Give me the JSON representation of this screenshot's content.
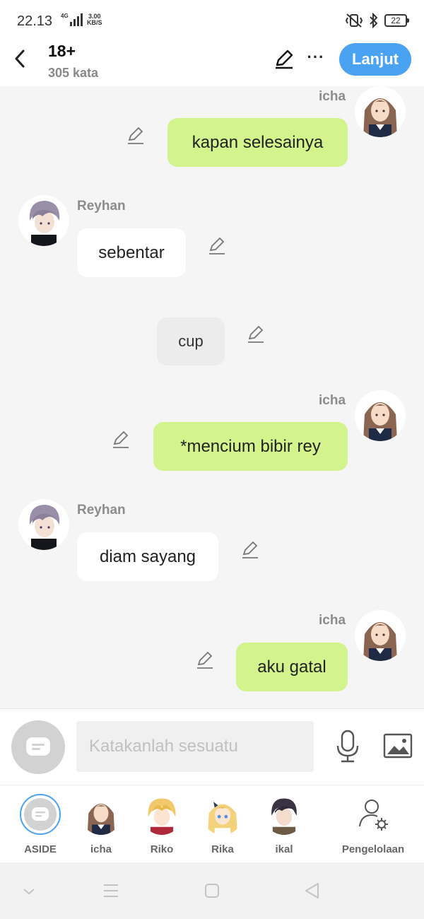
{
  "status_bar": {
    "time": "22.13",
    "network": "4G",
    "speed_top": "3.00",
    "speed_bottom": "KB/S",
    "battery": "22",
    "icons": [
      "vibrate-icon",
      "bluetooth-icon",
      "battery-icon"
    ]
  },
  "header": {
    "title": "18+",
    "word_count": "305 kata",
    "more_label": "···",
    "next_label": "Lanjut",
    "accent_color": "#4aa3f2"
  },
  "messages": [
    {
      "type": "me",
      "sender": "icha",
      "text": "kapan selesainya"
    },
    {
      "type": "other",
      "sender": "Reyhan",
      "text": "sebentar"
    },
    {
      "type": "aside",
      "sender": "",
      "text": "cup"
    },
    {
      "type": "me",
      "sender": "icha",
      "text": "*mencium bibir rey"
    },
    {
      "type": "other",
      "sender": "Reyhan",
      "text": "diam sayang"
    },
    {
      "type": "me",
      "sender": "icha",
      "text": "aku gatal"
    }
  ],
  "input": {
    "placeholder": "Katakanlah sesuatu",
    "value": ""
  },
  "characters": [
    {
      "label": "ASIDE",
      "selected": true
    },
    {
      "label": "icha",
      "selected": false
    },
    {
      "label": "Riko",
      "selected": false
    },
    {
      "label": "Rika",
      "selected": false
    },
    {
      "label": "ikal",
      "selected": false
    },
    {
      "label": "Pengelolaan",
      "selected": false
    }
  ],
  "colors": {
    "my_bubble": "#d3f38d",
    "other_bubble": "#ffffff",
    "aside_bubble": "#ececec"
  }
}
